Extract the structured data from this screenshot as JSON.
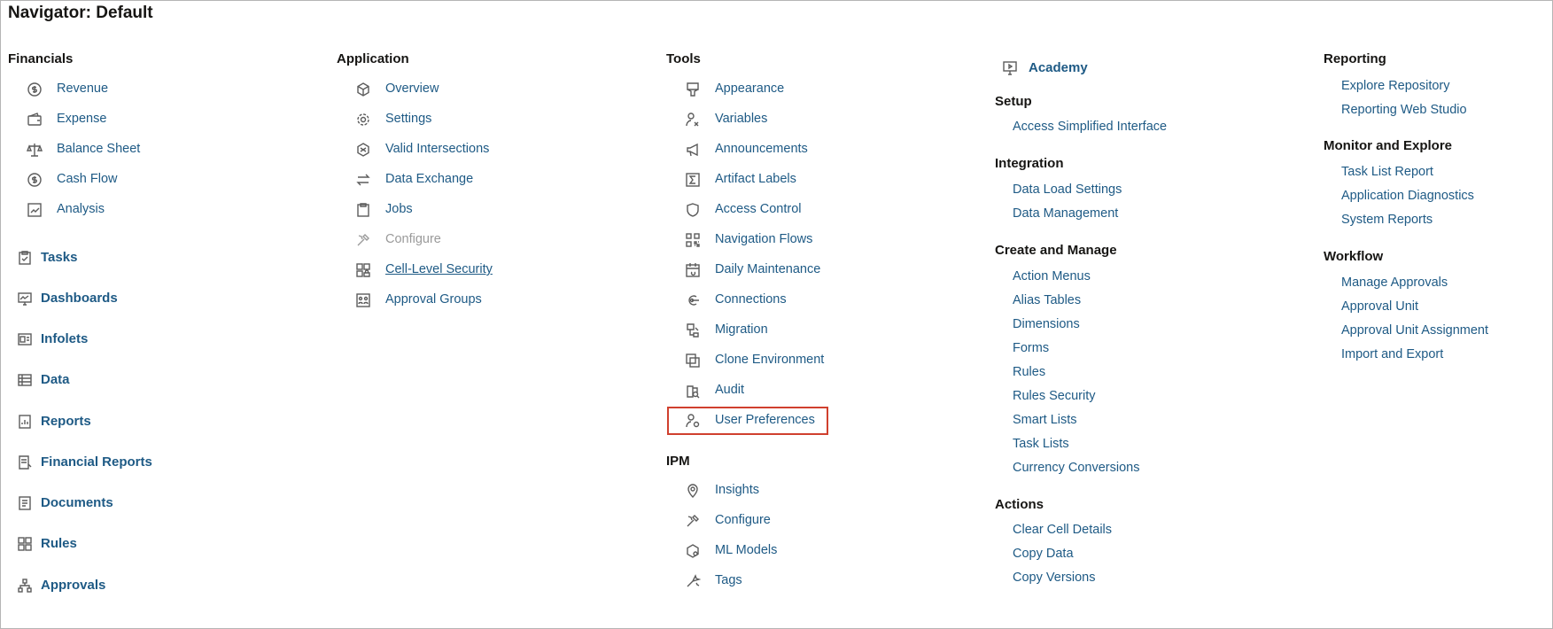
{
  "title": "Navigator: Default",
  "financials": {
    "heading": "Financials",
    "items": [
      {
        "label": "Revenue",
        "icon": "dollar-circle-icon"
      },
      {
        "label": "Expense",
        "icon": "wallet-icon"
      },
      {
        "label": "Balance Sheet",
        "icon": "scales-icon"
      },
      {
        "label": "Cash Flow",
        "icon": "dollar-circle-icon"
      },
      {
        "label": "Analysis",
        "icon": "analysis-icon"
      }
    ]
  },
  "clusters": [
    {
      "label": "Tasks",
      "icon": "clipboard-check-icon"
    },
    {
      "label": "Dashboards",
      "icon": "monitor-chart-icon"
    },
    {
      "label": "Infolets",
      "icon": "infolet-icon"
    },
    {
      "label": "Data",
      "icon": "table-icon"
    },
    {
      "label": "Reports",
      "icon": "report-icon"
    },
    {
      "label": "Financial Reports",
      "icon": "financial-report-icon"
    },
    {
      "label": "Documents",
      "icon": "document-icon"
    },
    {
      "label": "Rules",
      "icon": "rules-grid-icon"
    },
    {
      "label": "Approvals",
      "icon": "hierarchy-icon"
    }
  ],
  "application": {
    "heading": "Application",
    "items": [
      {
        "label": "Overview",
        "icon": "cube-icon"
      },
      {
        "label": "Settings",
        "icon": "gear-icon"
      },
      {
        "label": "Valid Intersections",
        "icon": "intersect-icon"
      },
      {
        "label": "Data Exchange",
        "icon": "exchange-arrows-icon"
      },
      {
        "label": "Jobs",
        "icon": "clipboard-icon"
      },
      {
        "label": "Configure",
        "icon": "tools-icon"
      },
      {
        "label": "Cell-Level Security",
        "icon": "cell-security-icon"
      },
      {
        "label": "Approval Groups",
        "icon": "group-icon"
      }
    ]
  },
  "tools": {
    "heading": "Tools",
    "items": [
      {
        "label": "Appearance",
        "icon": "brush-icon"
      },
      {
        "label": "Variables",
        "icon": "user-variable-icon"
      },
      {
        "label": "Announcements",
        "icon": "megaphone-icon"
      },
      {
        "label": "Artifact Labels",
        "icon": "sigma-icon"
      },
      {
        "label": "Access Control",
        "icon": "shield-icon"
      },
      {
        "label": "Navigation Flows",
        "icon": "qr-grid-icon"
      },
      {
        "label": "Daily Maintenance",
        "icon": "calendar-icon"
      },
      {
        "label": "Connections",
        "icon": "connection-icon"
      },
      {
        "label": "Migration",
        "icon": "migration-icon"
      },
      {
        "label": "Clone Environment",
        "icon": "clone-icon"
      },
      {
        "label": "Audit",
        "icon": "audit-icon"
      },
      {
        "label": "User Preferences",
        "icon": "user-gear-icon"
      }
    ]
  },
  "ipm": {
    "heading": "IPM",
    "items": [
      {
        "label": "Insights",
        "icon": "location-pin-icon"
      },
      {
        "label": "Configure",
        "icon": "tools-icon"
      },
      {
        "label": "ML Models",
        "icon": "ml-model-icon"
      },
      {
        "label": "Tags",
        "icon": "tag-sparkle-icon"
      }
    ]
  },
  "academy": {
    "label": "Academy",
    "icon": "monitor-play-icon"
  },
  "setup": {
    "heading": "Setup",
    "items": [
      "Access Simplified Interface"
    ]
  },
  "integration": {
    "heading": "Integration",
    "items": [
      "Data Load Settings",
      "Data Management"
    ]
  },
  "create_manage": {
    "heading": "Create and Manage",
    "items": [
      "Action Menus",
      "Alias Tables",
      "Dimensions",
      "Forms",
      "Rules",
      "Rules Security",
      "Smart Lists",
      "Task Lists",
      "Currency Conversions"
    ]
  },
  "actions": {
    "heading": "Actions",
    "items": [
      "Clear Cell Details",
      "Copy Data",
      "Copy Versions"
    ]
  },
  "reporting": {
    "heading": "Reporting",
    "items": [
      "Explore Repository",
      "Reporting Web Studio"
    ]
  },
  "monitor": {
    "heading": "Monitor and Explore",
    "items": [
      "Task List Report",
      "Application Diagnostics",
      "System Reports"
    ]
  },
  "workflow": {
    "heading": "Workflow",
    "items": [
      "Manage Approvals",
      "Approval Unit",
      "Approval Unit Assignment",
      "Import and Export"
    ]
  },
  "colors": {
    "link": "#1e5a85",
    "highlight_border": "#d0402e",
    "disabled": "#9a9a9a"
  }
}
